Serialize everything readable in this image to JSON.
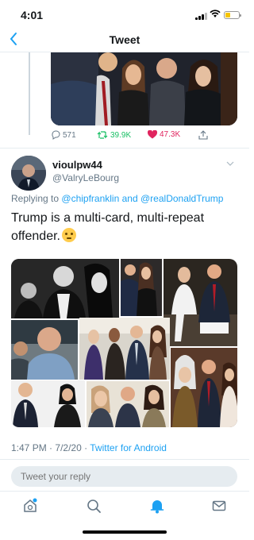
{
  "status_bar": {
    "time": "4:01"
  },
  "nav": {
    "title": "Tweet",
    "back_icon": "chevron-left-icon"
  },
  "previous_tweet": {
    "replies": "571",
    "retweets": "39.9K",
    "likes": "47.3K"
  },
  "tweet": {
    "display_name": "vioulpw44",
    "handle": "@ValryLeBourg",
    "replying_prefix": "Replying to",
    "mention_1": "@chipfranklin",
    "and_word": "and",
    "mention_2": "@realDonaldTrump",
    "text": "Trump is a multi-card, multi-repeat offender.",
    "emoji": "thinking-face",
    "time": "1:47 PM",
    "date": "7/2/20",
    "separator": "·",
    "source": "Twitter for Android"
  },
  "reply": {
    "placeholder": "Tweet your reply"
  },
  "tabs": [
    "home-icon",
    "search-icon",
    "notifications-icon",
    "messages-icon"
  ],
  "colors": {
    "accent": "#1da1f2",
    "retweet": "#17bf63",
    "like": "#e0245e",
    "secondary_text": "#657786",
    "divider": "#e6ecf0"
  }
}
